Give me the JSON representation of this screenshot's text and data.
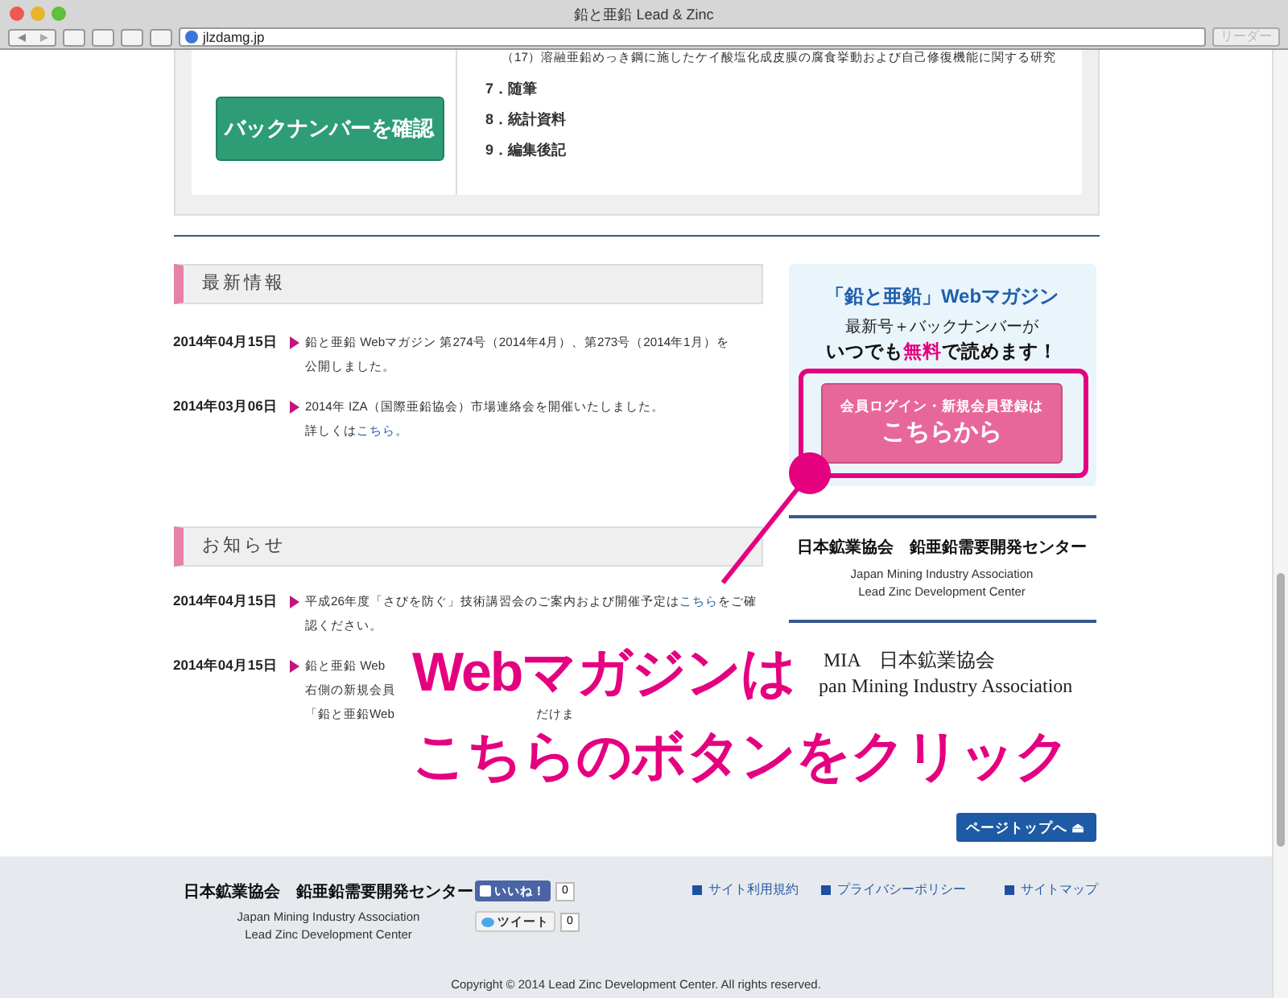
{
  "browser": {
    "title": "鉛と亜鉛  Lead & Zinc",
    "url": "jlzdamg.jp",
    "reader_button": "リーダー"
  },
  "top_box": {
    "button": "バックナンバーを確認",
    "items": [
      "（17）溶融亜鉛めっき鋼に施したケイ酸塩化成皮膜の腐食挙動および自己修復機能に関する研究",
      "7．随筆",
      "8．統計資料",
      "9．編集後記"
    ]
  },
  "news": {
    "heading": "最新情報",
    "entries": [
      {
        "date": "2014年04月15日",
        "lines": [
          [
            {
              "text": "鉛と亜鉛 Webマガジン 第274号（2014年4月）、第273号（2014年1月）を",
              "kind": "text"
            }
          ],
          [
            {
              "text": "公開しました。",
              "kind": "text"
            }
          ]
        ]
      },
      {
        "date": "2014年03月06日",
        "lines": [
          [
            {
              "text": "2014年 IZA（国際亜鉛協会）市場連絡会を開催いたしました。",
              "kind": "text"
            }
          ],
          [
            {
              "text": "詳しくは",
              "kind": "text"
            },
            {
              "text": "こちら",
              "kind": "link"
            },
            {
              "text": "。",
              "kind": "text"
            }
          ]
        ]
      }
    ]
  },
  "notices": {
    "heading": "お知らせ",
    "entries": [
      {
        "date": "2014年04月15日",
        "lines": [
          [
            {
              "text": "平成26年度「さびを防ぐ」技術講習会のご案内および開催予定は",
              "kind": "text"
            },
            {
              "text": "こちら",
              "kind": "link"
            },
            {
              "text": "をご確",
              "kind": "text"
            }
          ],
          [
            {
              "text": "認ください。",
              "kind": "text"
            }
          ]
        ]
      },
      {
        "date": "2014年04月15日",
        "lines": [
          [
            {
              "text": "鉛と亜鉛 Web",
              "kind": "text"
            }
          ],
          [
            {
              "text": "右側の新規会員",
              "kind": "text"
            }
          ],
          [
            {
              "text": "「鉛と亜鉛Web",
              "kind": "text"
            },
            {
              "text": "だけま",
              "kind": "after_gap"
            }
          ]
        ]
      }
    ]
  },
  "promo": {
    "title": "「鉛と亜鉛」Webマガジン",
    "line_1": "最新号＋バックナンバーが",
    "line_2": [
      {
        "text": "いつでも",
        "highlight": false
      },
      {
        "text": "無料",
        "highlight": true
      },
      {
        "text": "で読めます！",
        "highlight": false
      }
    ],
    "button_small": "会員ログイン・新規会員登録は",
    "button_large": "こちらから"
  },
  "org": {
    "name": "日本鉱業協会　鉛亜鉛需要開発センター",
    "english_1": "Japan Mining Industry Association",
    "english_2": "Lead Zinc Development Center"
  },
  "jmia_logo": {
    "line_1": "MIA　日本鉱業協会",
    "line_2": "pan Mining Industry Association"
  },
  "page_top_button": "ページトップへ ⏏",
  "footer": {
    "name": "日本鉱業協会　鉛亜鉛需要開発センター",
    "english_1": "Japan Mining Industry Association",
    "english_2": "Lead Zinc Development Center",
    "like_button": "いいね！",
    "like_count": "0",
    "tweet_button": "ツイート",
    "tweet_count": "0",
    "links": [
      "サイト利用規約",
      "プライバシーポリシー",
      "サイトマップ"
    ],
    "copyright": "Copyright © 2014 Lead Zinc Development Center. All rights reserved."
  },
  "callout": {
    "lines": [
      "Webマガジンは",
      "こちらのボタンをクリック"
    ]
  }
}
